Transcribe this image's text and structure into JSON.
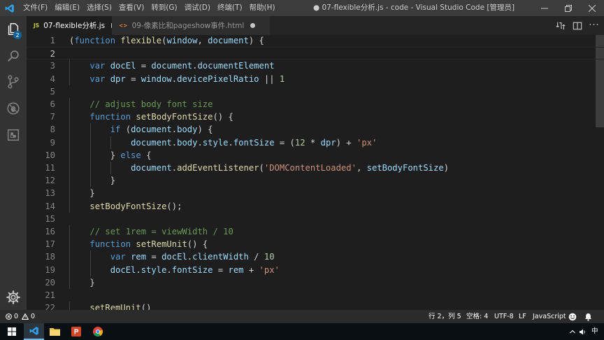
{
  "window": {
    "title": "● 07-flexible分析.js - code - Visual Studio Code [管理员]"
  },
  "menu": [
    "文件(F)",
    "编辑(E)",
    "选择(S)",
    "查看(V)",
    "转到(G)",
    "调试(D)",
    "终端(T)",
    "帮助(H)"
  ],
  "activity": {
    "explorer_badge": "2"
  },
  "tabs": [
    {
      "icon_text": "JS",
      "label": "07-flexible分析.js",
      "active": true,
      "dirty": true,
      "icon_color": "#cbcb41"
    },
    {
      "icon_text": "<>",
      "label": "09-像素比和pageshow事件.html",
      "active": false,
      "dirty": true,
      "icon_color": "#e37933"
    }
  ],
  "editor": {
    "line_numbers": [
      "1",
      "2",
      "3",
      "4",
      "5",
      "6",
      "7",
      "8",
      "9",
      "10",
      "11",
      "12",
      "13",
      "14",
      "15",
      "16",
      "17",
      "18",
      "19",
      "20",
      "21",
      "22"
    ],
    "current_line": 2,
    "lines": [
      [
        [
          "p",
          "("
        ],
        [
          "kw",
          "function "
        ],
        [
          "fn",
          "flexible"
        ],
        [
          "p",
          "("
        ],
        [
          "var",
          "window"
        ],
        [
          "p",
          ", "
        ],
        [
          "var",
          "document"
        ],
        [
          "p",
          ") {"
        ]
      ],
      [],
      [
        [
          "p",
          "    "
        ],
        [
          "kw",
          "var "
        ],
        [
          "var",
          "docEl"
        ],
        [
          "p",
          " = "
        ],
        [
          "var",
          "document"
        ],
        [
          "p",
          "."
        ],
        [
          "var",
          "documentElement"
        ]
      ],
      [
        [
          "p",
          "    "
        ],
        [
          "kw",
          "var "
        ],
        [
          "var",
          "dpr"
        ],
        [
          "p",
          " = "
        ],
        [
          "var",
          "window"
        ],
        [
          "p",
          "."
        ],
        [
          "var",
          "devicePixelRatio"
        ],
        [
          "p",
          " || "
        ],
        [
          "num",
          "1"
        ]
      ],
      [],
      [
        [
          "p",
          "    "
        ],
        [
          "cmt",
          "// adjust body font size"
        ]
      ],
      [
        [
          "p",
          "    "
        ],
        [
          "kw",
          "function "
        ],
        [
          "fn",
          "setBodyFontSize"
        ],
        [
          "p",
          "() {"
        ]
      ],
      [
        [
          "p",
          "        "
        ],
        [
          "kw",
          "if "
        ],
        [
          "p",
          "("
        ],
        [
          "var",
          "document"
        ],
        [
          "p",
          "."
        ],
        [
          "var",
          "body"
        ],
        [
          "p",
          ") {"
        ]
      ],
      [
        [
          "p",
          "            "
        ],
        [
          "var",
          "document"
        ],
        [
          "p",
          "."
        ],
        [
          "var",
          "body"
        ],
        [
          "p",
          "."
        ],
        [
          "var",
          "style"
        ],
        [
          "p",
          "."
        ],
        [
          "var",
          "fontSize"
        ],
        [
          "p",
          " = ("
        ],
        [
          "num",
          "12"
        ],
        [
          "p",
          " * "
        ],
        [
          "var",
          "dpr"
        ],
        [
          "p",
          ") + "
        ],
        [
          "str",
          "'px'"
        ]
      ],
      [
        [
          "p",
          "        } "
        ],
        [
          "kw",
          "else"
        ],
        [
          "p",
          " {"
        ]
      ],
      [
        [
          "p",
          "            "
        ],
        [
          "var",
          "document"
        ],
        [
          "p",
          "."
        ],
        [
          "fn",
          "addEventListener"
        ],
        [
          "p",
          "("
        ],
        [
          "str",
          "'DOMContentLoaded'"
        ],
        [
          "p",
          ", "
        ],
        [
          "var",
          "setBodyFontSize"
        ],
        [
          "p",
          ")"
        ]
      ],
      [
        [
          "p",
          "        }"
        ]
      ],
      [
        [
          "p",
          "    }"
        ]
      ],
      [
        [
          "p",
          "    "
        ],
        [
          "fn",
          "setBodyFontSize"
        ],
        [
          "p",
          "();"
        ]
      ],
      [],
      [
        [
          "p",
          "    "
        ],
        [
          "cmt",
          "// set 1rem = viewWidth / 10"
        ]
      ],
      [
        [
          "p",
          "    "
        ],
        [
          "kw",
          "function "
        ],
        [
          "fn",
          "setRemUnit"
        ],
        [
          "p",
          "() {"
        ]
      ],
      [
        [
          "p",
          "        "
        ],
        [
          "kw",
          "var "
        ],
        [
          "var",
          "rem"
        ],
        [
          "p",
          " = "
        ],
        [
          "var",
          "docEl"
        ],
        [
          "p",
          "."
        ],
        [
          "var",
          "clientWidth"
        ],
        [
          "p",
          " / "
        ],
        [
          "num",
          "10"
        ]
      ],
      [
        [
          "p",
          "        "
        ],
        [
          "var",
          "docEl"
        ],
        [
          "p",
          "."
        ],
        [
          "var",
          "style"
        ],
        [
          "p",
          "."
        ],
        [
          "var",
          "fontSize"
        ],
        [
          "p",
          " = "
        ],
        [
          "var",
          "rem"
        ],
        [
          "p",
          " + "
        ],
        [
          "str",
          "'px'"
        ]
      ],
      [
        [
          "p",
          "    }"
        ]
      ],
      [],
      [
        [
          "p",
          "    "
        ],
        [
          "fn",
          "setRemUnit"
        ],
        [
          "p",
          "()"
        ]
      ]
    ]
  },
  "status": {
    "errors": "0",
    "warnings": "0",
    "position": "行 2，列 5",
    "indent": "空格: 4",
    "encoding": "UTF-8",
    "eol": "LF",
    "language": "JavaScript"
  },
  "taskbar": {
    "ime": "中"
  },
  "colors": {
    "keyword": "#569cd6",
    "function": "#dcdcaa",
    "variable": "#9cdcfe",
    "string": "#ce9178",
    "number": "#b5cea8",
    "comment": "#6a9955"
  }
}
